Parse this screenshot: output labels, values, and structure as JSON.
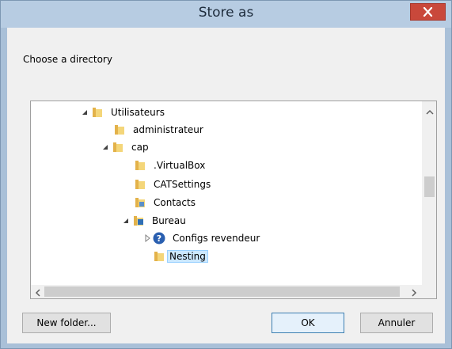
{
  "dialog": {
    "title": "Store as",
    "prompt": "Choose a directory"
  },
  "tree": {
    "items": [
      {
        "label": "Utilisateurs",
        "expanded": true,
        "icon": "folder-icon"
      },
      {
        "label": "administrateur",
        "icon": "folder-icon"
      },
      {
        "label": "cap",
        "expanded": true,
        "icon": "folder-icon"
      },
      {
        "label": ".VirtualBox",
        "icon": "folder-icon"
      },
      {
        "label": "CATSettings",
        "icon": "folder-icon"
      },
      {
        "label": "Contacts",
        "icon": "contacts-folder-icon"
      },
      {
        "label": "Bureau",
        "expanded": true,
        "icon": "desktop-folder-icon"
      },
      {
        "label": "Configs revendeur",
        "expanded": false,
        "icon": "help-icon"
      },
      {
        "label": "Nesting",
        "selected": true,
        "icon": "folder-icon"
      }
    ]
  },
  "buttons": {
    "new_folder": "New folder...",
    "ok": "OK",
    "cancel": "Annuler"
  },
  "colors": {
    "selection_bg": "#cce8ff",
    "close_button": "#c9483b",
    "title_bar": "#b7cce2"
  }
}
